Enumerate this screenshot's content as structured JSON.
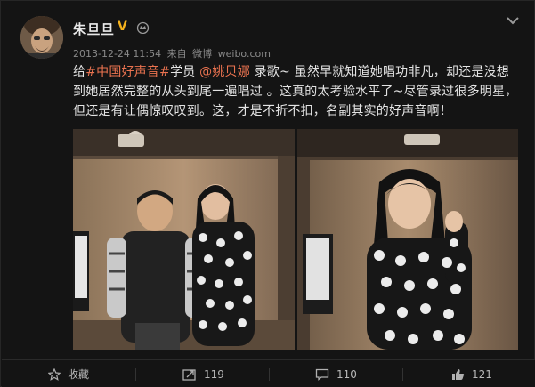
{
  "post": {
    "author": "朱旦旦",
    "timestamp": "2013-12-24 11:54",
    "source_prefix": "来自",
    "source": "微博",
    "source_domain": "weibo.com",
    "text": {
      "part1": "给",
      "hashtag": "#中国好声音#",
      "part2": "学员 ",
      "mention": "@姚贝娜",
      "part3": " 录歌~ 虽然早就知道她唱功非凡，却还是没想到她居然完整的从头到尾一遍唱过 。这真的太考验水平了~尽管录过很多明星，但还是有让偶惊叹叹到。这，才是不折不扣，名副其实的好声音啊！"
    }
  },
  "actions": {
    "favorite": "收藏",
    "repost_count": "119",
    "comment_count": "110",
    "like_count": "121"
  },
  "colors": {
    "link": "#eb7350",
    "badge": "#f4b11c"
  },
  "icons": {
    "verified": "v-badge-icon",
    "crown": "crown-icon",
    "menu": "chevron-down-icon",
    "favorite": "star-icon",
    "repost": "repost-icon",
    "comment": "comment-icon",
    "like": "thumbs-up-icon"
  }
}
